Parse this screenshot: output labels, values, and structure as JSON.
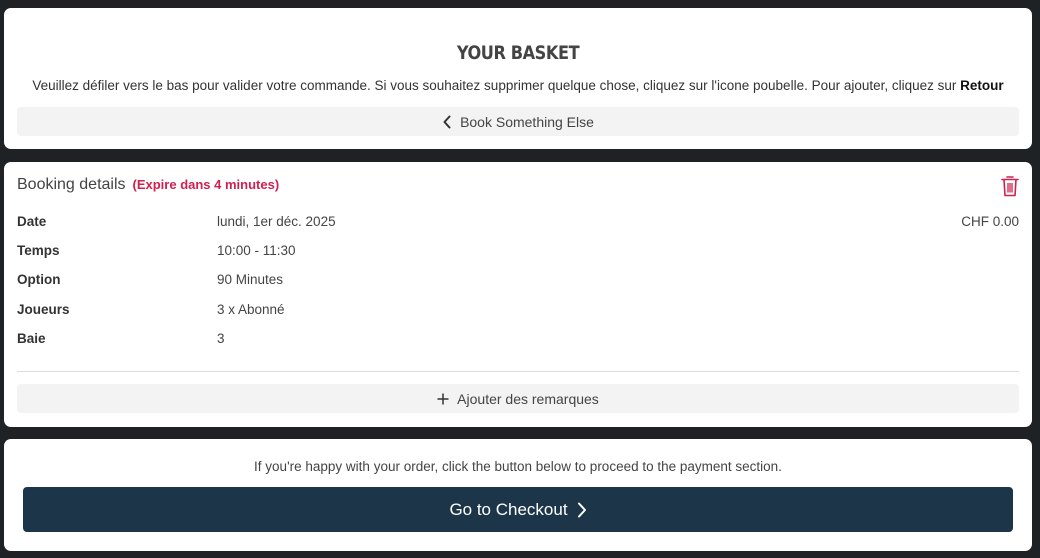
{
  "basket": {
    "title": "YOUR BASKET",
    "instructions": "Veuillez défiler vers le bas pour valider votre commande. Si vous souhaitez supprimer quelque chose, cliquez sur l'icone poubelle. Pour ajouter, cliquez sur",
    "instructions_bold": "Retour",
    "back_label": "Book Something Else"
  },
  "booking": {
    "heading": "Booking details",
    "expiry": "(Expire dans 4 minutes)",
    "price": "CHF 0.00",
    "rows": [
      {
        "key": "Date",
        "value": "lundi, 1er déc. 2025"
      },
      {
        "key": "Temps",
        "value": "10:00 - 11:30"
      },
      {
        "key": "Option",
        "value": "90 Minutes"
      },
      {
        "key": "Joueurs",
        "value": "3 x Abonné"
      },
      {
        "key": "Baie",
        "value": "3"
      }
    ],
    "remarks_label": "Ajouter des remarques"
  },
  "checkout": {
    "info": "If you're happy with your order, click the button below to proceed to the payment section.",
    "button_label": "Go to Checkout"
  },
  "colors": {
    "accent": "#d11f4e",
    "checkout_button": "#1c3549",
    "page_background": "#1f2224"
  },
  "icons": [
    "chevron-left-icon",
    "trash-icon",
    "plus-icon",
    "chevron-right-icon"
  ]
}
